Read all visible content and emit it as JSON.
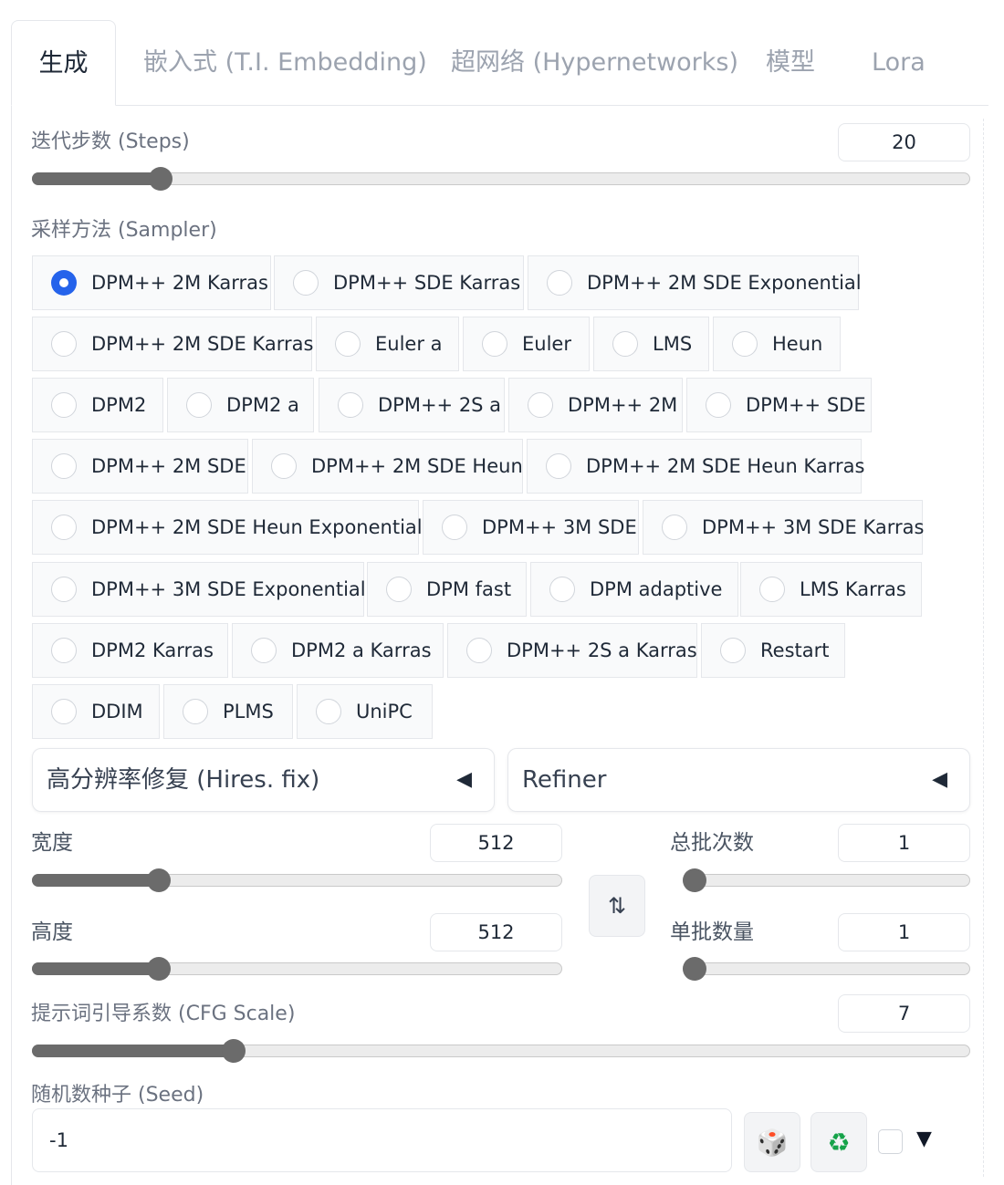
{
  "tabs": [
    {
      "label": "生成"
    },
    {
      "label": "嵌入式 (T.I. Embedding)"
    },
    {
      "label": "超网络 (Hypernetworks)"
    },
    {
      "label": "模型"
    },
    {
      "label": "Lora"
    }
  ],
  "steps": {
    "label": "迭代步数 (Steps)",
    "value": "20",
    "fraction": 0.137
  },
  "sampler": {
    "label": "采样方法 (Sampler)",
    "selected": "DPM++ 2M Karras",
    "options": [
      "DPM++ 2M Karras",
      "DPM++ SDE Karras",
      "DPM++ 2M SDE Exponential",
      "DPM++ 2M SDE Karras",
      "Euler a",
      "Euler",
      "LMS",
      "Heun",
      "DPM2",
      "DPM2 a",
      "DPM++ 2S a",
      "DPM++ 2M",
      "DPM++ SDE",
      "DPM++ 2M SDE",
      "DPM++ 2M SDE Heun",
      "DPM++ 2M SDE Heun Karras",
      "DPM++ 2M SDE Heun Exponential",
      "DPM++ 3M SDE",
      "DPM++ 3M SDE Karras",
      "DPM++ 3M SDE Exponential",
      "DPM fast",
      "DPM adaptive",
      "LMS Karras",
      "DPM2 Karras",
      "DPM2 a Karras",
      "DPM++ 2S a Karras",
      "Restart",
      "DDIM",
      "PLMS",
      "UniPC"
    ]
  },
  "accordions": {
    "hires": {
      "label": "高分辨率修复 (Hires. fix)",
      "arrow": "◀"
    },
    "refiner": {
      "label": "Refiner",
      "arrow": "◀"
    }
  },
  "width": {
    "label": "宽度",
    "value": "512",
    "fraction": 0.24
  },
  "height": {
    "label": "高度",
    "value": "512",
    "fraction": 0.24
  },
  "batch_count": {
    "label": "总批次数",
    "value": "1",
    "fraction": 0.0
  },
  "batch_size": {
    "label": "单批数量",
    "value": "1",
    "fraction": 0.0
  },
  "swap": {
    "icon": "⇅"
  },
  "cfg": {
    "label": "提示词引导系数 (CFG Scale)",
    "value": "7",
    "fraction": 0.215
  },
  "seed": {
    "label": "随机数种子 (Seed)",
    "value": "-1",
    "dice_icon": "🎲",
    "recycle_icon": "♻",
    "expand_arrow": "▼"
  }
}
